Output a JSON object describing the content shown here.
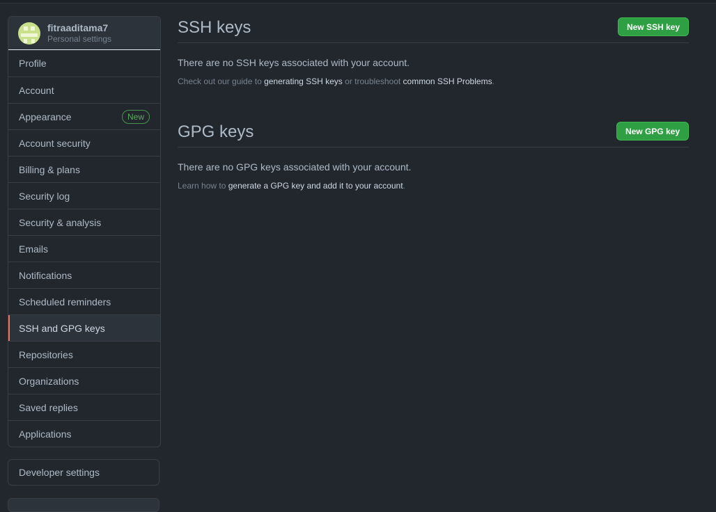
{
  "user": {
    "username": "fitraaditama7",
    "subtitle": "Personal settings"
  },
  "sidebar": {
    "items": [
      {
        "label": "Profile"
      },
      {
        "label": "Account"
      },
      {
        "label": "Appearance",
        "badge": "New"
      },
      {
        "label": "Account security"
      },
      {
        "label": "Billing & plans"
      },
      {
        "label": "Security log"
      },
      {
        "label": "Security & analysis"
      },
      {
        "label": "Emails"
      },
      {
        "label": "Notifications"
      },
      {
        "label": "Scheduled reminders"
      },
      {
        "label": "SSH and GPG keys",
        "selected": true
      },
      {
        "label": "Repositories"
      },
      {
        "label": "Organizations"
      },
      {
        "label": "Saved replies"
      },
      {
        "label": "Applications"
      }
    ],
    "developer_settings": "Developer settings"
  },
  "ssh": {
    "title": "SSH keys",
    "button": "New SSH key",
    "empty": "There are no SSH keys associated with your account.",
    "note_pre": "Check out our guide to ",
    "note_link1": "generating SSH keys",
    "note_mid": " or troubleshoot ",
    "note_link2": "common SSH Problems",
    "note_end": "."
  },
  "gpg": {
    "title": "GPG keys",
    "button": "New GPG key",
    "empty": "There are no GPG keys associated with your account.",
    "note_pre": "Learn how to ",
    "note_link": "generate a GPG key and add it to your account",
    "note_end": "."
  },
  "colors": {
    "background": "#22272e",
    "accent_selected": "#ec775c",
    "button_green": "#2ea043",
    "badge_green": "#57ab5a"
  }
}
